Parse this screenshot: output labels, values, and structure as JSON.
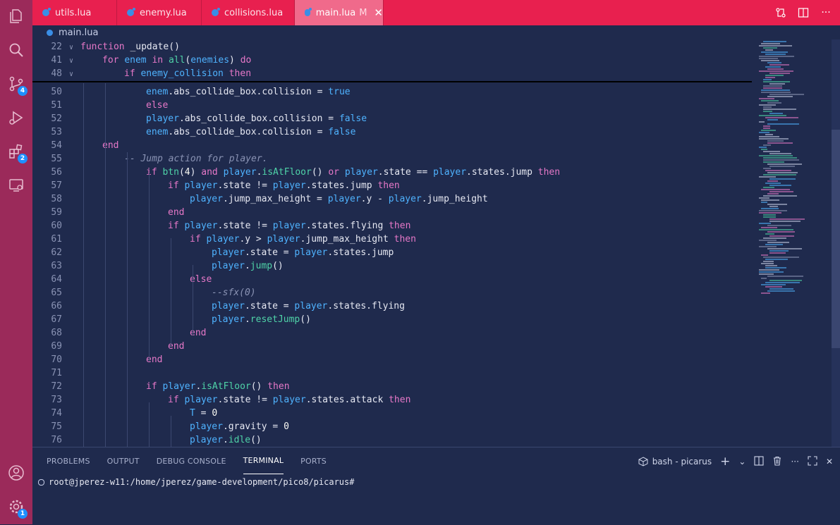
{
  "tabs": [
    {
      "name": "utils.lua",
      "active": false,
      "modified": ""
    },
    {
      "name": "enemy.lua",
      "active": false,
      "modified": ""
    },
    {
      "name": "collisions.lua",
      "active": false,
      "modified": ""
    },
    {
      "name": "main.lua",
      "active": true,
      "modified": "M"
    }
  ],
  "breadcrumb": {
    "file": "main.lua"
  },
  "activity": {
    "items": [
      {
        "icon": "files-icon"
      },
      {
        "icon": "search-icon"
      },
      {
        "icon": "source-control-icon",
        "badge": "4"
      },
      {
        "icon": "run-debug-icon"
      },
      {
        "icon": "extensions-icon",
        "badge": "2"
      },
      {
        "icon": "remote-explorer-icon"
      }
    ],
    "bottom": [
      {
        "icon": "account-icon"
      },
      {
        "icon": "settings-gear-icon",
        "badge": "1"
      }
    ]
  },
  "editor": {
    "sticky": [
      {
        "n": "22",
        "fold": "v",
        "indent": 0,
        "tokens": [
          [
            "kw",
            "function"
          ],
          [
            "code",
            " _update()"
          ]
        ]
      },
      {
        "n": "41",
        "fold": "v",
        "indent": 1,
        "tokens": [
          [
            "kw",
            "for"
          ],
          [
            "code",
            " "
          ],
          [
            "var",
            "enem"
          ],
          [
            "code",
            " "
          ],
          [
            "kw",
            "in"
          ],
          [
            "code",
            " "
          ],
          [
            "fn",
            "all"
          ],
          [
            "code",
            "("
          ],
          [
            "var",
            "enemies"
          ],
          [
            "code",
            ") "
          ],
          [
            "kw",
            "do"
          ]
        ]
      },
      {
        "n": "48",
        "fold": "v",
        "indent": 2,
        "tokens": [
          [
            "kw",
            "if"
          ],
          [
            "code",
            " "
          ],
          [
            "var",
            "enemy_collision"
          ],
          [
            "code",
            " "
          ],
          [
            "kw",
            "then"
          ]
        ]
      }
    ],
    "lines": [
      {
        "n": "50",
        "indent": 3,
        "tokens": [
          [
            "var",
            "enem"
          ],
          [
            "code",
            ".abs_collide_box.collision = "
          ],
          [
            "bool",
            "true"
          ]
        ]
      },
      {
        "n": "51",
        "indent": 3,
        "tokens": [
          [
            "kw",
            "else"
          ]
        ]
      },
      {
        "n": "52",
        "indent": 3,
        "tokens": [
          [
            "var",
            "player"
          ],
          [
            "code",
            ".abs_collide_box.collision = "
          ],
          [
            "bool",
            "false"
          ]
        ]
      },
      {
        "n": "53",
        "indent": 3,
        "tokens": [
          [
            "var",
            "enem"
          ],
          [
            "code",
            ".abs_collide_box.collision = "
          ],
          [
            "bool",
            "false"
          ]
        ]
      },
      {
        "n": "54",
        "indent": 1,
        "tokens": [
          [
            "kw",
            "end"
          ]
        ]
      },
      {
        "n": "55",
        "indent": 2,
        "tokens": [
          [
            "cmt",
            "-- Jump action for player."
          ]
        ]
      },
      {
        "n": "56",
        "indent": 3,
        "tokens": [
          [
            "kw",
            "if"
          ],
          [
            "code",
            " "
          ],
          [
            "fn",
            "btn"
          ],
          [
            "code",
            "("
          ],
          [
            "num",
            "4"
          ],
          [
            "code",
            ") "
          ],
          [
            "kw",
            "and"
          ],
          [
            "code",
            " "
          ],
          [
            "var",
            "player"
          ],
          [
            "code",
            "."
          ],
          [
            "fn",
            "isAtFloor"
          ],
          [
            "code",
            "() "
          ],
          [
            "kw",
            "or"
          ],
          [
            "code",
            " "
          ],
          [
            "var",
            "player"
          ],
          [
            "code",
            ".state == "
          ],
          [
            "var",
            "player"
          ],
          [
            "code",
            ".states.jump "
          ],
          [
            "kw",
            "then"
          ]
        ]
      },
      {
        "n": "57",
        "indent": 4,
        "tokens": [
          [
            "kw",
            "if"
          ],
          [
            "code",
            " "
          ],
          [
            "var",
            "player"
          ],
          [
            "code",
            ".state != "
          ],
          [
            "var",
            "player"
          ],
          [
            "code",
            ".states.jump "
          ],
          [
            "kw",
            "then"
          ]
        ]
      },
      {
        "n": "58",
        "indent": 5,
        "tokens": [
          [
            "var",
            "player"
          ],
          [
            "code",
            ".jump_max_height = "
          ],
          [
            "var",
            "player"
          ],
          [
            "code",
            ".y - "
          ],
          [
            "var",
            "player"
          ],
          [
            "code",
            ".jump_height"
          ]
        ]
      },
      {
        "n": "59",
        "indent": 4,
        "tokens": [
          [
            "kw",
            "end"
          ]
        ]
      },
      {
        "n": "60",
        "indent": 4,
        "tokens": [
          [
            "kw",
            "if"
          ],
          [
            "code",
            " "
          ],
          [
            "var",
            "player"
          ],
          [
            "code",
            ".state != "
          ],
          [
            "var",
            "player"
          ],
          [
            "code",
            ".states.flying "
          ],
          [
            "kw",
            "then"
          ]
        ]
      },
      {
        "n": "61",
        "indent": 5,
        "tokens": [
          [
            "kw",
            "if"
          ],
          [
            "code",
            " "
          ],
          [
            "var",
            "player"
          ],
          [
            "code",
            ".y > "
          ],
          [
            "var",
            "player"
          ],
          [
            "code",
            ".jump_max_height "
          ],
          [
            "kw",
            "then"
          ]
        ]
      },
      {
        "n": "62",
        "indent": 6,
        "tokens": [
          [
            "var",
            "player"
          ],
          [
            "code",
            ".state = "
          ],
          [
            "var",
            "player"
          ],
          [
            "code",
            ".states.jump"
          ]
        ]
      },
      {
        "n": "63",
        "indent": 6,
        "tokens": [
          [
            "var",
            "player"
          ],
          [
            "code",
            "."
          ],
          [
            "fn",
            "jump"
          ],
          [
            "code",
            "()"
          ]
        ]
      },
      {
        "n": "64",
        "indent": 5,
        "tokens": [
          [
            "kw",
            "else"
          ]
        ]
      },
      {
        "n": "65",
        "indent": 6,
        "tokens": [
          [
            "cmt",
            "--sfx(0)"
          ]
        ]
      },
      {
        "n": "66",
        "indent": 6,
        "tokens": [
          [
            "var",
            "player"
          ],
          [
            "code",
            ".state = "
          ],
          [
            "var",
            "player"
          ],
          [
            "code",
            ".states.flying"
          ]
        ]
      },
      {
        "n": "67",
        "indent": 6,
        "tokens": [
          [
            "var",
            "player"
          ],
          [
            "code",
            "."
          ],
          [
            "fn",
            "resetJump"
          ],
          [
            "code",
            "()"
          ]
        ]
      },
      {
        "n": "68",
        "indent": 5,
        "tokens": [
          [
            "kw",
            "end"
          ]
        ]
      },
      {
        "n": "69",
        "indent": 4,
        "tokens": [
          [
            "kw",
            "end"
          ]
        ]
      },
      {
        "n": "70",
        "indent": 3,
        "tokens": [
          [
            "kw",
            "end"
          ]
        ]
      },
      {
        "n": "71",
        "indent": 0,
        "tokens": []
      },
      {
        "n": "72",
        "indent": 3,
        "tokens": [
          [
            "kw",
            "if"
          ],
          [
            "code",
            " "
          ],
          [
            "var",
            "player"
          ],
          [
            "code",
            "."
          ],
          [
            "fn",
            "isAtFloor"
          ],
          [
            "code",
            "() "
          ],
          [
            "kw",
            "then"
          ]
        ]
      },
      {
        "n": "73",
        "indent": 4,
        "tokens": [
          [
            "kw",
            "if"
          ],
          [
            "code",
            " "
          ],
          [
            "var",
            "player"
          ],
          [
            "code",
            ".state != "
          ],
          [
            "var",
            "player"
          ],
          [
            "code",
            ".states.attack "
          ],
          [
            "kw",
            "then"
          ]
        ]
      },
      {
        "n": "74",
        "indent": 5,
        "tokens": [
          [
            "var",
            "T"
          ],
          [
            "code",
            " = "
          ],
          [
            "num",
            "0"
          ]
        ]
      },
      {
        "n": "75",
        "indent": 5,
        "tokens": [
          [
            "var",
            "player"
          ],
          [
            "code",
            ".gravity = "
          ],
          [
            "num",
            "0"
          ]
        ]
      },
      {
        "n": "76",
        "indent": 5,
        "tokens": [
          [
            "var",
            "player"
          ],
          [
            "code",
            "."
          ],
          [
            "fn",
            "idle"
          ],
          [
            "code",
            "()"
          ]
        ]
      }
    ]
  },
  "panel": {
    "tabs": [
      "PROBLEMS",
      "OUTPUT",
      "DEBUG CONSOLE",
      "TERMINAL",
      "PORTS"
    ],
    "active_tab": "TERMINAL",
    "terminal_name": "bash - picarus",
    "prompt": "root@jperez-w11:/home/jperez/game-development/pico8/picarus#"
  },
  "colors": {
    "accent": "#e8204f",
    "activity": "#9b2a5a",
    "editor_bg": "#1f2a4d",
    "badge": "#1e90ff"
  }
}
